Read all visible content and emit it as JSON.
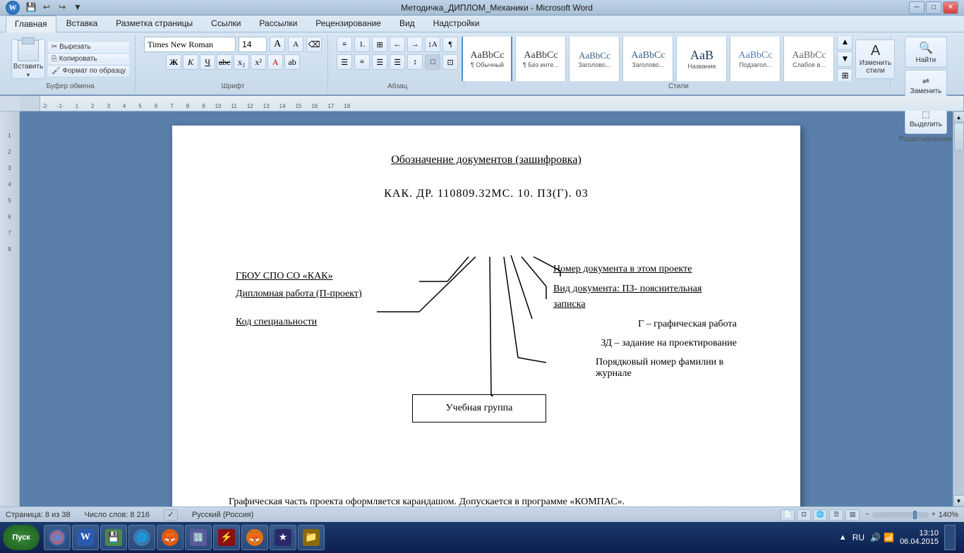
{
  "titlebar": {
    "title": "Методичка_ДИПЛОМ_Механики - Microsoft Word",
    "minimize": "─",
    "maximize": "□",
    "close": "✕"
  },
  "ribbon": {
    "tabs": [
      "Главная",
      "Вставка",
      "Разметка страницы",
      "Ссылки",
      "Рассылки",
      "Рецензирование",
      "Вид",
      "Надстройки"
    ],
    "active_tab": "Главная",
    "font_name": "Times New Roman",
    "font_size": "14",
    "clipboard_label": "Буфер обмена",
    "font_label": "Шрифт",
    "paragraph_label": "Абзац",
    "styles_label": "Стили",
    "edit_label": "Редактирование",
    "buttons": {
      "paste": "Вставить",
      "cut": "Вырезать",
      "copy": "Копировать",
      "format_painter": "Формат по образцу",
      "find": "Найти",
      "replace": "Заменить",
      "select": "Выделить",
      "change_styles": "Изменить стили"
    },
    "styles": [
      {
        "name": "Обычный",
        "label": "¶ Обычный"
      },
      {
        "name": "Без инте...",
        "label": "¶ Без инте..."
      },
      {
        "name": "Заголово...",
        "label": "Заголово..."
      },
      {
        "name": "Заголово...",
        "label": "Заголово..."
      },
      {
        "name": "Название",
        "label": "Название"
      },
      {
        "name": "Подзагол...",
        "label": "Подзагол..."
      },
      {
        "name": "Слабое в...",
        "label": "Слабое в..."
      }
    ]
  },
  "document": {
    "title": "Обозначение документов (зашифровка)",
    "code": "КАК. ДР. 110809.32МС. 10. ПЗ(Г). 03",
    "labels": {
      "gbou": "ГБОУ СПО СО «КАК»",
      "diploma": "Дипломная работа (П-проект)",
      "specialty": "Код специальности",
      "nom_doc": "Номер документа в этом проекте",
      "vid_doc": "Вид документа: ПЗ- пояснительная",
      "zapiska": "записка",
      "g_label": "Г – графическая работа",
      "zd_label": "ЗД – задание на проектирование",
      "poryadok": "Порядковый номер фамилии в журнале",
      "group_box": "Учебная группа"
    },
    "bottom_text": "Графическая часть проекта оформляется карандашом. Допускается в программе «КОМПАС»."
  },
  "statusbar": {
    "page": "Страница: 8 из 38",
    "words": "Число слов: 8 216",
    "lang": "Русский (Россия)",
    "zoom": "140%"
  },
  "taskbar": {
    "start": "Пуск",
    "time": "13:10",
    "date": "06.04.2015",
    "lang": "RU"
  }
}
